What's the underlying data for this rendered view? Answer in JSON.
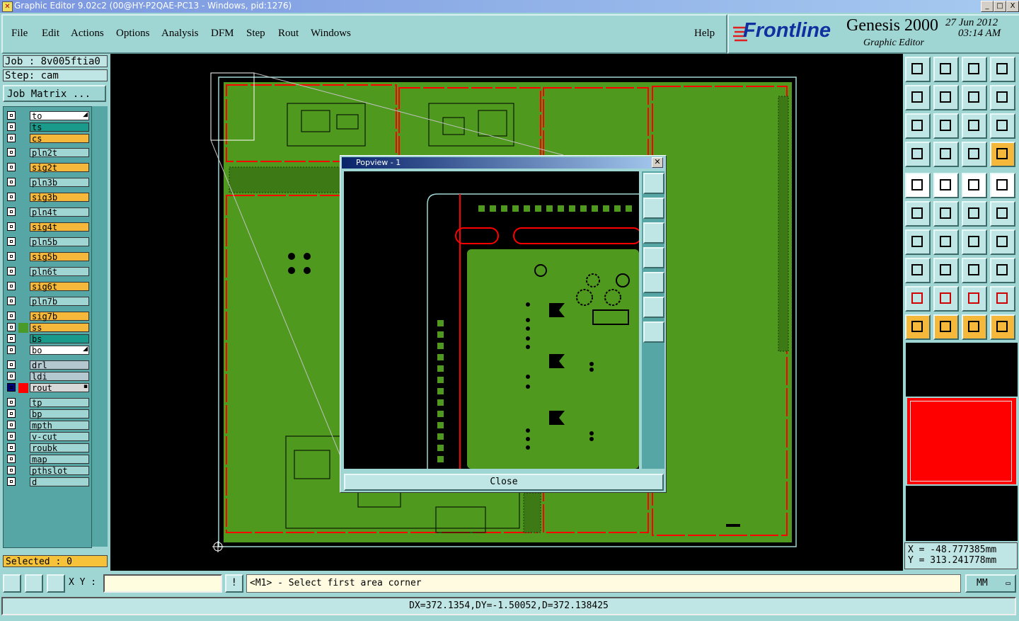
{
  "window": {
    "title": "Graphic Editor 9.02c2 (00@HY-P2QAE-PC13 - Windows, pid:1276)",
    "min_label": "_",
    "max_label": "□",
    "close_label": "X"
  },
  "menu": {
    "items": [
      "File",
      "Edit",
      "Actions",
      "Options",
      "Analysis",
      "DFM",
      "Step",
      "Rout",
      "Windows"
    ],
    "help": "Help"
  },
  "logo": {
    "brand": "Frontline",
    "product": "Genesis 2000",
    "subtitle": "Graphic Editor",
    "date": "27 Jun 2012",
    "time": "03:14 AM"
  },
  "job": {
    "job_label": "Job : 8v005ftia0",
    "step_label": "Step: cam",
    "matrix_button": "Job Matrix ..."
  },
  "layers": [
    {
      "name": "to",
      "color": "#ffffff",
      "marker": true
    },
    {
      "name": "ts",
      "color": "#1a9a8a"
    },
    {
      "name": "cs",
      "color": "#f5b83a"
    },
    {
      "name": "pln2t",
      "color": "#9fd6d4"
    },
    {
      "name": "sig2t",
      "color": "#f5b83a"
    },
    {
      "name": "pln3b",
      "color": "#9fd6d4"
    },
    {
      "name": "sig3b",
      "color": "#f5b83a"
    },
    {
      "name": "pln4t",
      "color": "#9fd6d4"
    },
    {
      "name": "sig4t",
      "color": "#f5b83a"
    },
    {
      "name": "pln5b",
      "color": "#9fd6d4"
    },
    {
      "name": "sig5b",
      "color": "#f5b83a"
    },
    {
      "name": "pln6t",
      "color": "#9fd6d4"
    },
    {
      "name": "sig6t",
      "color": "#f5b83a"
    },
    {
      "name": "pln7b",
      "color": "#9fd6d4"
    },
    {
      "name": "sig7b",
      "color": "#f5b83a"
    },
    {
      "name": "ss",
      "color": "#f5b83a",
      "swatch": "#4a9a2a"
    },
    {
      "name": "bs",
      "color": "#1a9a8a"
    },
    {
      "name": "bo",
      "color": "#ffffff",
      "marker": true
    },
    {
      "name": "drl",
      "color": "#b4c8d0"
    },
    {
      "name": "ldi",
      "color": "#b4c8d0"
    },
    {
      "name": "rout",
      "color": "#d8d8d8",
      "swatch": "#ff0000",
      "active": true
    },
    {
      "name": "tp",
      "color": "#9fd6d4"
    },
    {
      "name": "bp",
      "color": "#9fd6d4"
    },
    {
      "name": "mpth",
      "color": "#9fd6d4"
    },
    {
      "name": "v-cut",
      "color": "#9fd6d4"
    },
    {
      "name": "roubk",
      "color": "#9fd6d4"
    },
    {
      "name": "map",
      "color": "#9fd6d4"
    },
    {
      "name": "pthslot",
      "color": "#9fd6d4"
    },
    {
      "name": "d",
      "color": "#9fd6d4"
    }
  ],
  "selected": "Selected : 0",
  "popview": {
    "title": "Popview - 1",
    "close_button": "Close"
  },
  "coords": {
    "x": "X =  -48.777385mm",
    "y": "Y =  313.241778mm"
  },
  "bottom": {
    "xy_label": "X Y :",
    "xy_value": "",
    "prompt": "<M1> - Select first area corner",
    "units": "MM"
  },
  "status": "DX=372.1354,DY=-1.50052,D=372.138425",
  "colors": {
    "panel": "#9fd6d4",
    "board_green": "#4f9a1e",
    "rout_red": "#ff0000",
    "accent_orange": "#f5b83a"
  }
}
